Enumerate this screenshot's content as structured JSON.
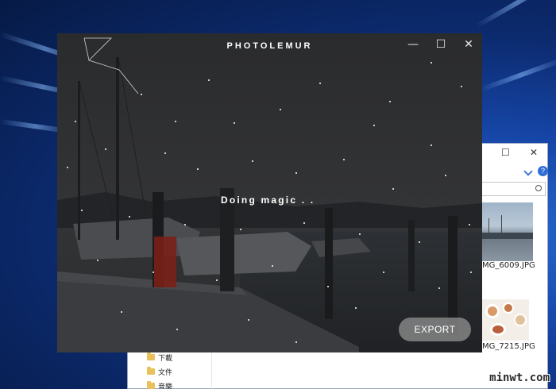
{
  "app": {
    "title": "PHOTOLEMUR",
    "controls": {
      "minimize": "—",
      "maximize": "☐",
      "close": "✕"
    },
    "status_text": "Doing magic . .",
    "export_label": "EXPORT"
  },
  "explorer": {
    "controls": {
      "maximize": "☐",
      "close": "✕"
    },
    "thumbnails": [
      {
        "name": "MG_6009.JPG"
      },
      {
        "name": "MG_7215.JPG"
      }
    ],
    "nav_items": [
      {
        "label": "下載"
      },
      {
        "label": "文件"
      },
      {
        "label": "音樂"
      }
    ]
  },
  "watermark": "minwt.com"
}
